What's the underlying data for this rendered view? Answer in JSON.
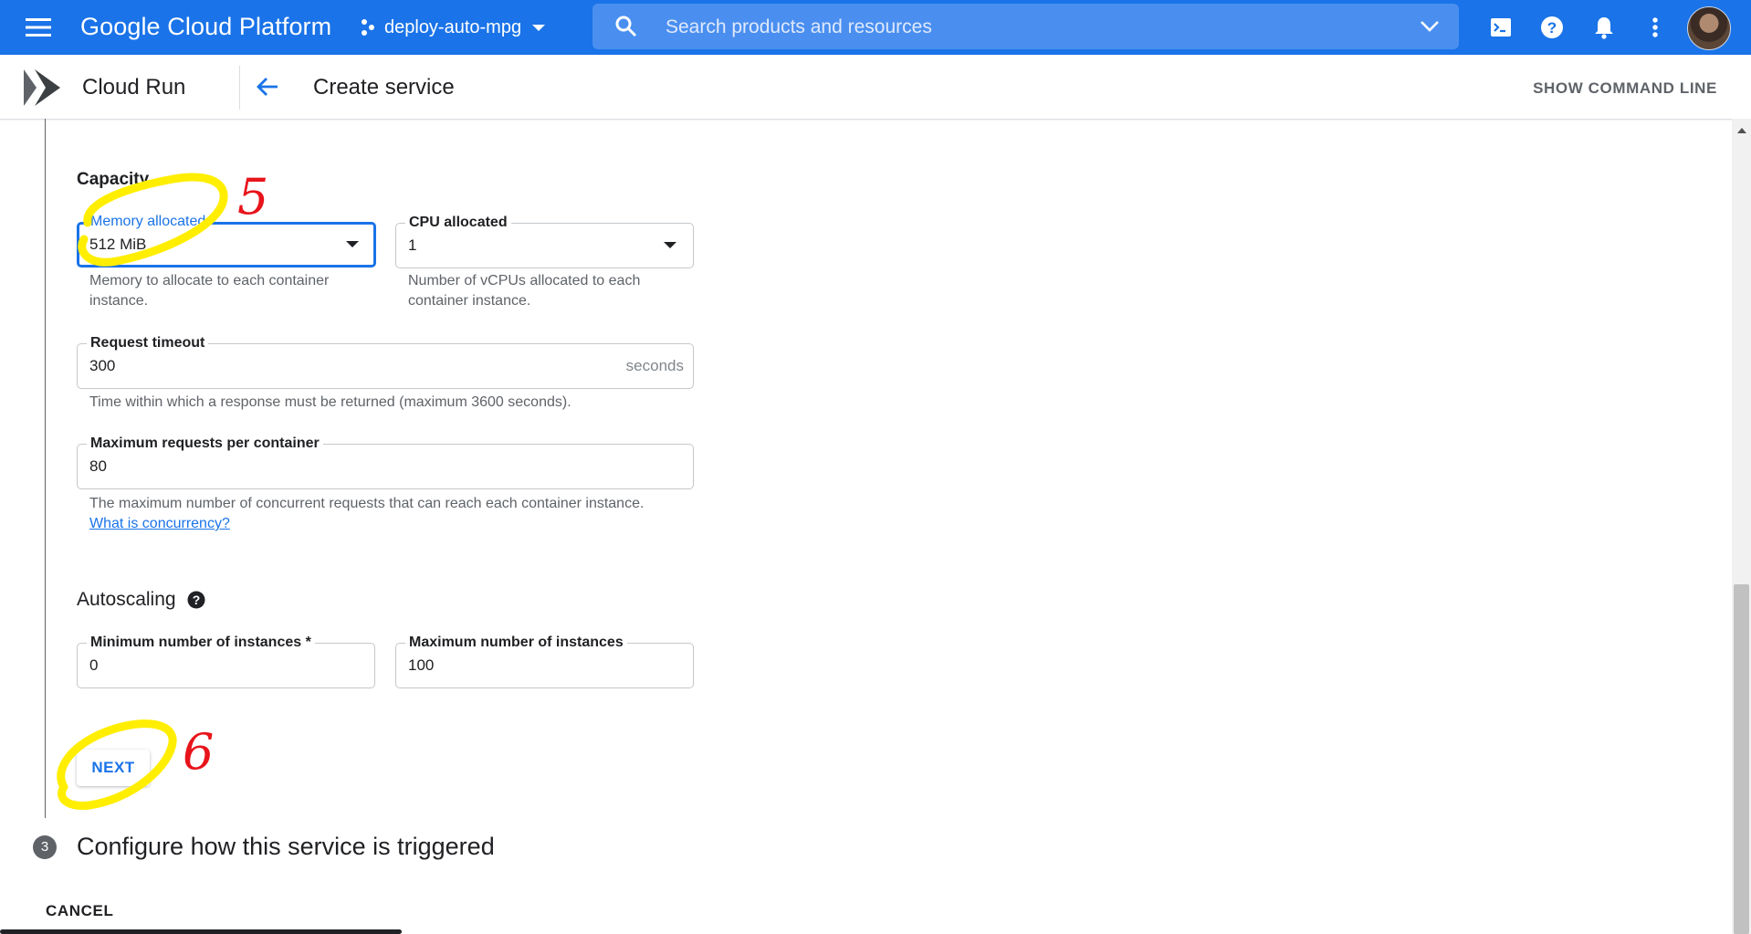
{
  "topbar": {
    "brand": "Google Cloud Platform",
    "project": "deploy-auto-mpg",
    "search_placeholder": "Search products and resources"
  },
  "subbar": {
    "product": "Cloud Run",
    "title": "Create service",
    "show_command_line": "SHOW COMMAND LINE"
  },
  "capacity": {
    "heading": "Capacity",
    "memory": {
      "label": "Memory allocated",
      "value": "512 MiB",
      "hint": "Memory to allocate to each container instance."
    },
    "cpu": {
      "label": "CPU allocated",
      "value": "1",
      "hint": "Number of vCPUs allocated to each container instance."
    },
    "timeout": {
      "label": "Request timeout",
      "value": "300",
      "suffix": "seconds",
      "hint": "Time within which a response must be returned (maximum 3600 seconds)."
    },
    "max_requests": {
      "label": "Maximum requests per container",
      "value": "80",
      "hint": "The maximum number of concurrent requests that can reach each container instance.",
      "link": "What is concurrency?"
    }
  },
  "autoscaling": {
    "heading": "Autoscaling",
    "min": {
      "label": "Minimum number of instances *",
      "value": "0"
    },
    "max": {
      "label": "Maximum number of instances",
      "value": "100"
    }
  },
  "buttons": {
    "next": "NEXT",
    "cancel": "CANCEL"
  },
  "step3": {
    "number": "3",
    "title": "Configure how this service is triggered"
  },
  "annotations": {
    "five": "5",
    "six": "6",
    "highlight_color": "#ffee00",
    "mark_color": "#e8141b"
  },
  "colors": {
    "primary": "#1a73e8"
  }
}
